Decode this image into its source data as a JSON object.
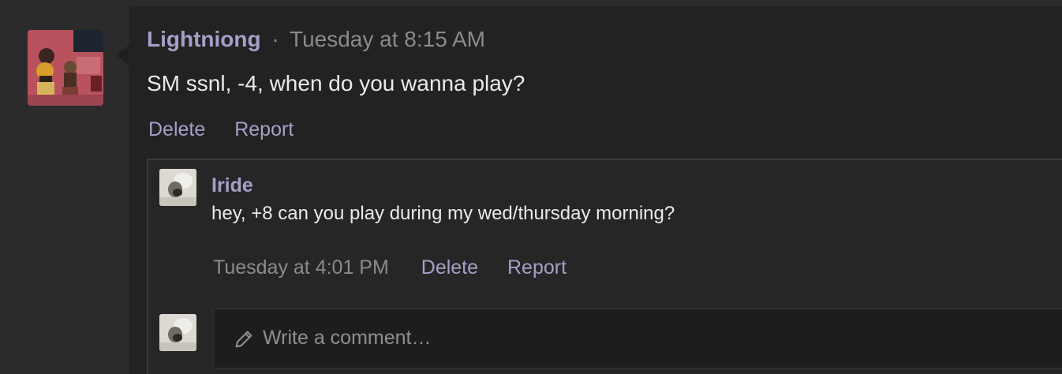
{
  "post": {
    "author": "Lightniong",
    "separator": "·",
    "timestamp": "Tuesday at 8:15 AM",
    "message": "SM ssnl, -4, when do you wanna play?",
    "actions": {
      "delete_label": "Delete",
      "report_label": "Report"
    }
  },
  "reply": {
    "author": "Iride",
    "message": "hey, +8 can you play during my wed/thursday morning?",
    "timestamp": "Tuesday at 4:01 PM",
    "actions": {
      "delete_label": "Delete",
      "report_label": "Report"
    }
  },
  "comment": {
    "placeholder": "Write a comment…",
    "icon": "pencil-icon"
  },
  "colors": {
    "username": "#a79fc9",
    "link": "#a79fc9",
    "muted": "#8b8b8b",
    "text": "#eaeaea",
    "background": "#222222"
  }
}
